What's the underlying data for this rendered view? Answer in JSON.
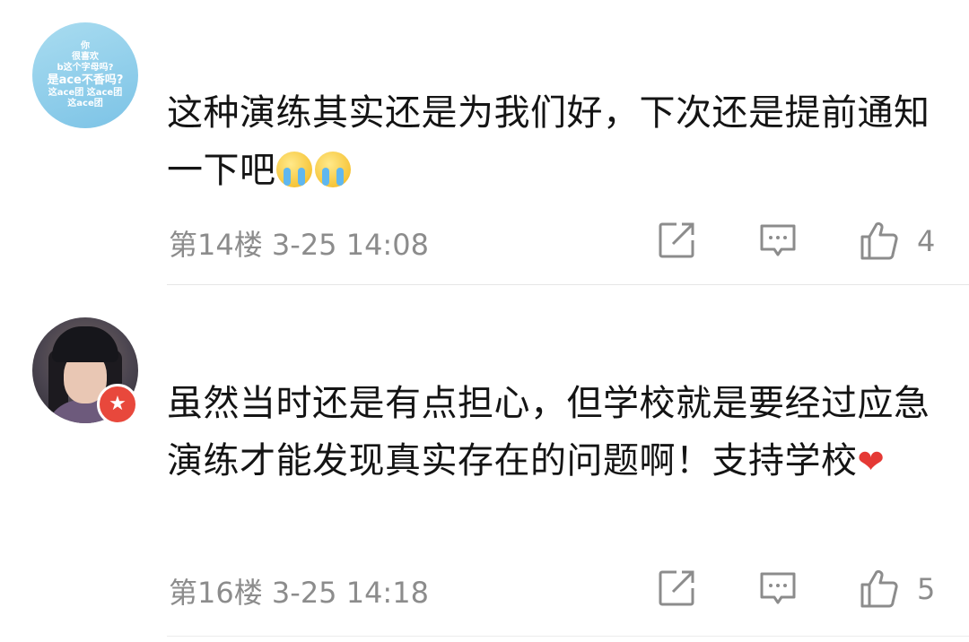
{
  "comments": [
    {
      "avatar_lines": [
        "你",
        "很喜欢",
        "b这个字母吗?",
        "是ace不香吗?",
        "这ace团 这ace团",
        "这ace团"
      ],
      "text": "这种演练其实还是为我们好，下次还是提前通知一下吧",
      "emoji": [
        "loudly-crying-face",
        "loudly-crying-face"
      ],
      "floor": "第14楼",
      "time": "3-25 14:08",
      "likes": "4"
    },
    {
      "avatar_badge": "★",
      "text": "虽然当时还是有点担心，但学校就是要经过应急演练才能发现真实存在的问题啊！支持学校",
      "emoji": [
        "heart"
      ],
      "heart": "❤",
      "floor": "第16楼",
      "time": "3-25 14:18",
      "likes": "5"
    }
  ],
  "icons": {
    "share": "share-icon",
    "reply": "comment-icon",
    "like": "thumbs-up-icon"
  },
  "colors": {
    "meta_text": "#8c8c8c",
    "badge": "#e8483c",
    "avatar_bg": "#8fcdea"
  }
}
